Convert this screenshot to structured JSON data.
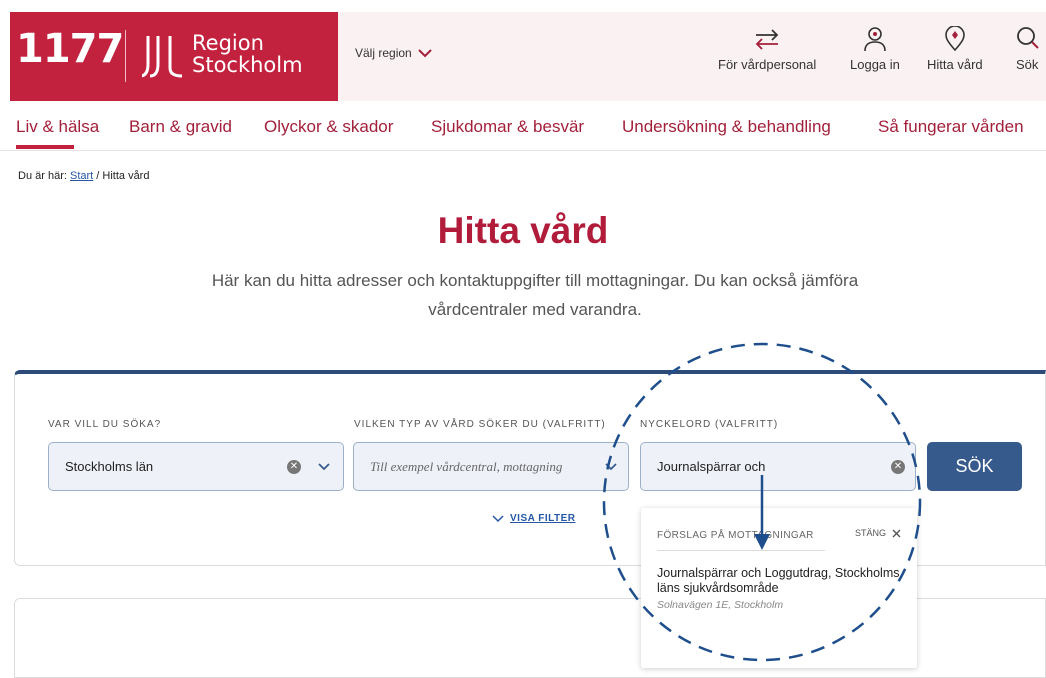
{
  "header": {
    "logo_1177": "1177",
    "logo_region_line1": "Region",
    "logo_region_line2": "Stockholm",
    "region_select": "Välj region",
    "tools": [
      {
        "label": "För vårdpersonal",
        "icon": "arrows-swap-icon"
      },
      {
        "label": "Logga in",
        "icon": "user-icon"
      },
      {
        "label": "Hitta vård",
        "icon": "location-pin-icon"
      },
      {
        "label": "Sök",
        "icon": "search-icon"
      }
    ],
    "brand_color": "#c3223f"
  },
  "nav": {
    "items": [
      "Liv & hälsa",
      "Barn & gravid",
      "Olyckor & skador",
      "Sjukdomar & besvär",
      "Undersökning & behandling",
      "Så fungerar vården"
    ],
    "active": "Liv & hälsa"
  },
  "breadcrumb": {
    "prefix": "Du är här:",
    "start": "Start",
    "current": "/ Hitta vård"
  },
  "page": {
    "title": "Hitta vård",
    "intro": "Här kan du hitta adresser och kontaktuppgifter till mottagningar. Du kan också jämföra vårdcentraler med varandra."
  },
  "search": {
    "where_label": "VAR VILL DU SÖKA?",
    "where_value": "Stockholms län",
    "type_label": "VILKEN TYP AV VÅRD SÖKER DU (VALFRITT)",
    "type_placeholder": "Till exempel vårdcentral, mottagning",
    "keyword_label": "NYCKELORD (VALFRITT)",
    "keyword_value": "Journalspärrar och",
    "submit": "SÖK",
    "show_filter": "VISA FILTER",
    "button_color": "#375a8c"
  },
  "suggestions": {
    "heading": "FÖRSLAG PÅ MOTTAGNINGAR",
    "close": "STÄNG",
    "items": [
      {
        "title": "Journalspärrar och Loggutdrag, Stockholms läns sjukvårdsområde",
        "address": "Solnavägen 1E, Stockholm"
      }
    ]
  },
  "annotation_color": "#1f4e8c"
}
